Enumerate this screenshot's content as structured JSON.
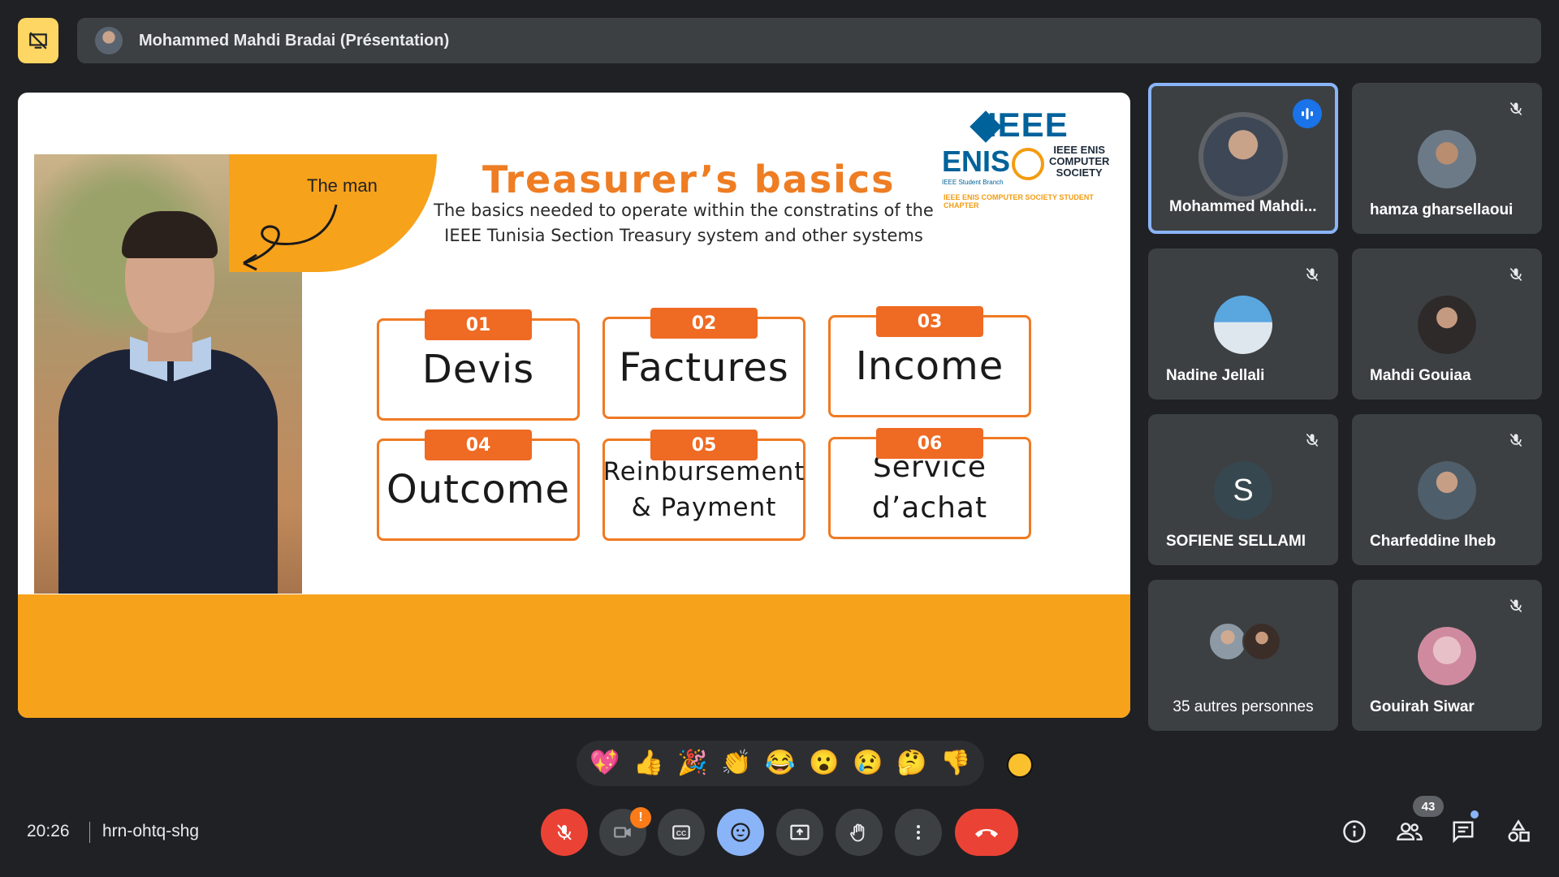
{
  "header": {
    "presenter_title": "Mohammed Mahdi Bradai (Présentation)"
  },
  "slide": {
    "the_man_label": "The man",
    "title": "Treasurer’s basics",
    "subtitle_line1": "The basics needed to operate within the constratins of the",
    "subtitle_line2": "IEEE Tunisia Section Treasury system and other systems",
    "logo": {
      "ieee": "IEEE",
      "enis": "ENIS",
      "enis_small": "IEEE Student Branch",
      "cs_line1": "IEEE ENIS",
      "cs_line2": "COMPUTER",
      "cs_line3": "SOCIETY",
      "cs_bottom": "IEEE ENIS COMPUTER SOCIETY STUDENT CHAPTER"
    },
    "cards": [
      {
        "num": "01",
        "label": "Devis"
      },
      {
        "num": "02",
        "label": "Factures"
      },
      {
        "num": "03",
        "label": "Income"
      },
      {
        "num": "04",
        "label": "Outcome"
      },
      {
        "num": "05",
        "label_line1": "Reinbursement",
        "label_line2": "& Payment"
      },
      {
        "num": "06",
        "label_line1": "Service",
        "label_line2": "d’achat"
      }
    ]
  },
  "participants": [
    {
      "name": "Mohammed Mahdi...",
      "speaking": true
    },
    {
      "name": "hamza gharsellaoui",
      "muted": true
    },
    {
      "name": "Nadine Jellali",
      "muted": true
    },
    {
      "name": "Mahdi Gouiaa",
      "muted": true
    },
    {
      "name": "SOFIENE SELLAMI",
      "initial": "S",
      "muted": true
    },
    {
      "name": "Charfeddine Iheb",
      "muted": true
    },
    {
      "name": "35 autres personnes"
    },
    {
      "name": "Gouirah Siwar",
      "muted": true
    }
  ],
  "reactions": [
    "💖",
    "👍",
    "🎉",
    "👏",
    "😂",
    "😮",
    "😢",
    "🤔",
    "👎"
  ],
  "meeting": {
    "time": "20:26",
    "code": "hrn-ohtq-shg",
    "participant_count": "43",
    "camera_warning": "!"
  },
  "colors": {
    "accent_orange": "#f7a21b",
    "card_orange": "#ef6a22",
    "meet_red": "#ea4335",
    "meet_blue": "#8ab4f8",
    "ieee_blue": "#00629b"
  },
  "icons": [
    "present-off-icon",
    "mic-off-icon",
    "camera-off-icon",
    "captions-icon",
    "emoji-icon",
    "present-icon",
    "raise-hand-icon",
    "more-icon",
    "end-call-icon",
    "info-icon",
    "people-icon",
    "chat-icon",
    "activities-icon",
    "speaking-icon"
  ]
}
